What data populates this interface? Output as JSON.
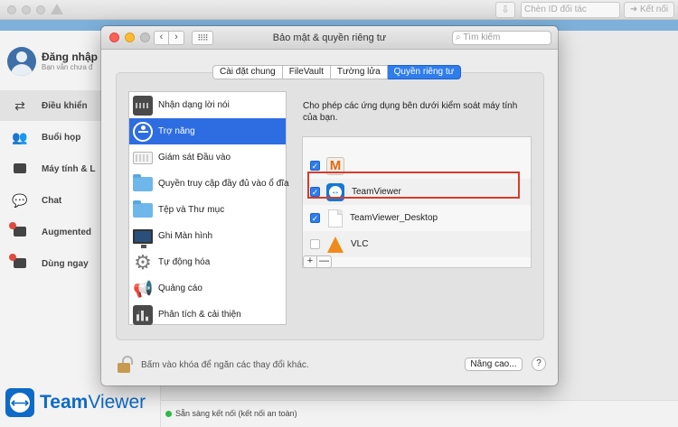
{
  "teamviewer": {
    "partner_placeholder": "Chèn ID đối tác",
    "connect_label": "Kết nối",
    "login_title": "Đăng nhập",
    "login_subtitle": "Bạn vẫn chưa đ",
    "nav": [
      {
        "label": "Điều khiển",
        "icon": "arrows-icon"
      },
      {
        "label": "Buổi họp",
        "icon": "people-icon"
      },
      {
        "label": "Máy tính & L",
        "icon": "contacts-icon"
      },
      {
        "label": "Chat",
        "icon": "chat-icon"
      },
      {
        "label": "Augmented",
        "icon": "augmented-icon"
      },
      {
        "label": "Dùng ngay",
        "icon": "engage-icon"
      }
    ],
    "logo_text_a": "Team",
    "logo_text_b": "Viewer",
    "status_text": "Sẵn sàng kết nối (kết nối an toàn)"
  },
  "sysprefs": {
    "title": "Bảo mật & quyền riêng tư",
    "search_placeholder": "Tìm kiếm",
    "tabs": [
      {
        "label": "Cài đặt chung",
        "active": false
      },
      {
        "label": "FileVault",
        "active": false
      },
      {
        "label": "Tường lửa",
        "active": false
      },
      {
        "label": "Quyền riêng tư",
        "active": true
      }
    ],
    "categories": [
      {
        "label": "Nhận dạng lời nói",
        "icon": "speech-icon"
      },
      {
        "label": "Trợ năng",
        "icon": "accessibility-icon"
      },
      {
        "label": "Giám sát Đầu vào",
        "icon": "keyboard-icon"
      },
      {
        "label": "Quyền truy cập đầy đủ vào ổ đĩa",
        "icon": "folder-icon"
      },
      {
        "label": "Tệp và Thư mục",
        "icon": "folder-icon"
      },
      {
        "label": "Ghi Màn hình",
        "icon": "monitor-icon"
      },
      {
        "label": "Tự động hóa",
        "icon": "gear-icon"
      },
      {
        "label": "Quảng cáo",
        "icon": "megaphone-icon"
      },
      {
        "label": "Phân tích & cải thiện",
        "icon": "chart-icon"
      }
    ],
    "description": "Cho phép các ứng dụng bên dưới kiểm soát máy tính của bạn.",
    "apps": [
      {
        "name": "",
        "checked": true,
        "icon": "m-app-icon"
      },
      {
        "name": "TeamViewer",
        "checked": true,
        "icon": "teamviewer-icon"
      },
      {
        "name": "TeamViewer_Desktop",
        "checked": true,
        "icon": "document-icon"
      },
      {
        "name": "VLC",
        "checked": false,
        "icon": "vlc-icon"
      }
    ],
    "add_label": "+",
    "remove_label": "—",
    "lock_text": "Bấm vào khóa để ngăn các thay đổi khác.",
    "advanced_label": "Nâng cao...",
    "help_label": "?"
  }
}
